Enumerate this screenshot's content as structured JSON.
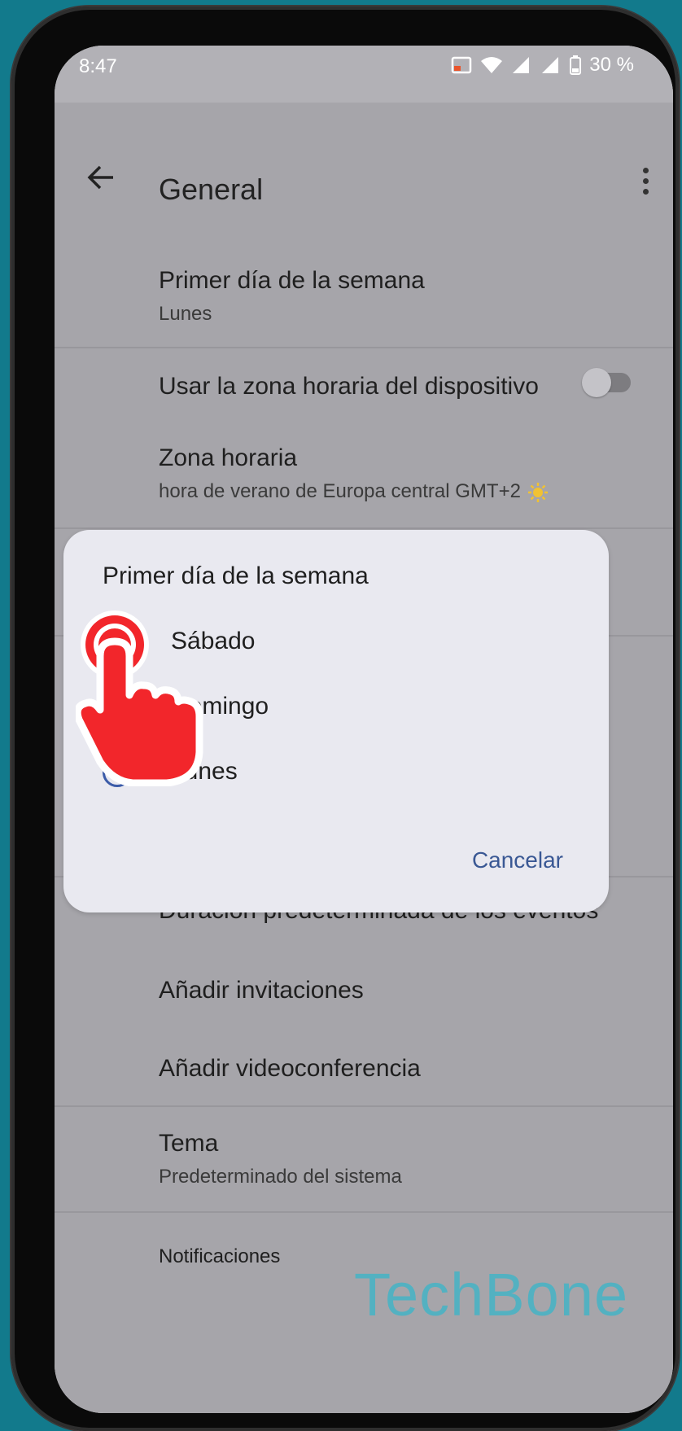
{
  "status": {
    "time": "8:47",
    "battery": "30 %"
  },
  "appbar": {
    "title": "General"
  },
  "settings": {
    "first_day": {
      "title": "Primer día de la semana",
      "value": "Lunes"
    },
    "device_tz": {
      "title": "Usar la zona horaria del dispositivo",
      "enabled": false
    },
    "timezone": {
      "title": "Zona horaria",
      "value": "hora de verano de Europa central  GMT+2"
    },
    "event_duration": {
      "title": "Duración predeterminada de los eventos"
    },
    "invitations": {
      "title": "Añadir invitaciones"
    },
    "videoconf": {
      "title": "Añadir videoconferencia"
    },
    "theme": {
      "title": "Tema",
      "value": "Predeterminado del sistema"
    },
    "notifications": {
      "title": "Notificaciones"
    }
  },
  "dialog": {
    "title": "Primer día de la semana",
    "options": [
      "Sábado",
      "Domingo",
      "Lunes"
    ],
    "selected": "Lunes",
    "cancel_label": "Cancelar"
  },
  "watermark": "TechBone",
  "colors": {
    "accent": "#3b5ba8",
    "tap_indicator": "#f2262b",
    "background": "#127a8c"
  }
}
